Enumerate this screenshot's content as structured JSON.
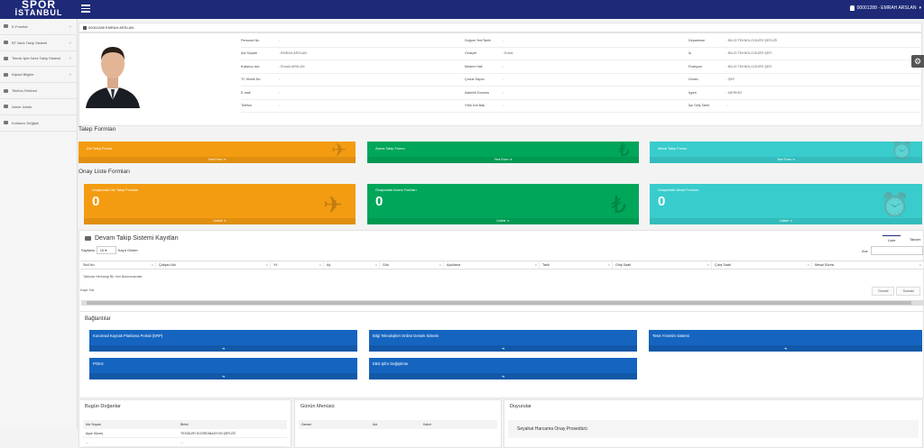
{
  "brand": {
    "line1": "SPOR",
    "line2": "İSTANBUL"
  },
  "user": {
    "label": "00001288 - EMRAH ARSLAN"
  },
  "sidebar": {
    "items": [
      {
        "label": "E-Formlar",
        "chevron": "˅"
      },
      {
        "label": "BT İstek Takip Sistemi",
        "chevron": "˅"
      },
      {
        "label": "Teknik İşler İstek Takip Sistemi",
        "chevron": "˅"
      },
      {
        "label": "Kişisel Bilgiler",
        "chevron": "˅"
      },
      {
        "label": "Telefon Rehberi",
        "chevron": ""
      },
      {
        "label": "İzinler İzinde",
        "chevron": ""
      },
      {
        "label": "Kullanıcı Değiştir",
        "chevron": ""
      }
    ]
  },
  "profile": {
    "header": "00001288 EMRAH ARSLAN",
    "rows": [
      [
        {
          "k": "Personel No",
          "v": ":"
        },
        {
          "k": "Doğum Yeri/Tarihi",
          "v": ":"
        },
        {
          "k": "Departman",
          "v": ": BİLGİ TEKNOLOJİLERİ ŞEFLİĞİ"
        }
      ],
      [
        {
          "k": "Adı Soyadı",
          "v": ": EMRAH ARSLAN"
        },
        {
          "k": "Cinsiyet",
          "v": ": Erkek"
        },
        {
          "k": "İş",
          "v": ": BİLGİ TEKNOLOJİLERİ ŞEFİ"
        }
      ],
      [
        {
          "k": "Kullanıcı Adı",
          "v": ": Emrah ARSLAN"
        },
        {
          "k": "Medeni Hali",
          "v": ":"
        },
        {
          "k": "Pozisyon",
          "v": ": BİLGİ TEKNOLOJİLERİ ŞEFİ"
        }
      ],
      [
        {
          "k": "TC Kimlik No",
          "v": ":"
        },
        {
          "k": "Çocuk Sayısı",
          "v": ":"
        },
        {
          "k": "Unvan",
          "v": ": ŞEF"
        }
      ],
      [
        {
          "k": "E-mail",
          "v": ":"
        },
        {
          "k": "Askerlik Durumu",
          "v": ":"
        },
        {
          "k": "İşyeri",
          "v": ": MERKEZ"
        }
      ],
      [
        {
          "k": "Telefon",
          "v": ":"
        },
        {
          "k": "Yıllık İzin Bak.",
          "v": ":"
        },
        {
          "k": "İşe Giriş Tarihi",
          "v": ":"
        }
      ]
    ]
  },
  "talep": {
    "title": "Talep Formları",
    "cards": [
      {
        "title": "İzin Talep Formu",
        "footer": "Yeni Form",
        "icon": "plane-icon",
        "glyph": "✈"
      },
      {
        "title": "Avans Talep Formu",
        "footer": "Yeni Form",
        "icon": "lira-icon",
        "glyph": "₺"
      },
      {
        "title": "Mesai Talep Formu",
        "footer": "Yeni Form",
        "icon": "alarm-clock-icon",
        "glyph": "⏰"
      }
    ]
  },
  "onay": {
    "title": "Onay Liste Formları",
    "cards": [
      {
        "title": "Onaymdaki İzin Talep Formları",
        "count": "0",
        "footer": "Listele",
        "icon": "plane-icon",
        "glyph": "✈"
      },
      {
        "title": "Onaymdaki Avans Formları",
        "count": "0",
        "footer": "Listele",
        "icon": "lira-icon",
        "glyph": "₺"
      },
      {
        "title": "Onaymdaki Mesai Formları",
        "count": "0",
        "footer": "Listele",
        "icon": "alarm-clock-icon",
        "glyph": "⏰"
      }
    ]
  },
  "devam": {
    "title": "Devam Takip Sistemi Kayıtları",
    "tabs": [
      "Liste",
      "Takvim"
    ],
    "page_label": "Sayfada",
    "page_size": "10",
    "page_suffix": "Kayıt Göster",
    "search_label": "Ara:",
    "columns": [
      "Sicil No",
      "Çalışan Adı",
      "Yıl",
      "Ay",
      "Gün",
      "Açıklama",
      "Tarih",
      "Giriş Saati",
      "Çıkış Saati",
      "Mesai Süresi"
    ],
    "empty": "Tabloda Herhangi Bir Veri Bulunmamakt",
    "info": "Kayıt Yok",
    "prev": "Önceki",
    "next": "Sonraki"
  },
  "baglantilar": {
    "title": "Bağlantılar",
    "links": [
      {
        "label": "Kurumsal Kaynak Planlama Portalı (ERP)"
      },
      {
        "label": "Bilgi Teknolojileri Online Destek Sistemi"
      },
      {
        "label": "Tesis Yönetim Sistemi"
      },
      {
        "label": "POKS"
      },
      {
        "label": "EBS Şifre Değiştirme"
      }
    ]
  },
  "bugun": {
    "title": "Bugün Doğanlar",
    "col1": "Adı Soyadı",
    "col2": "Birimi",
    "rows": [
      {
        "name": "Ayşe Güneş",
        "unit": "TESİSLER KOORDİNASYON ŞEFLİĞİ"
      },
      {
        "name": "...",
        "unit": "..."
      }
    ]
  },
  "menu": {
    "title": "Günün Menüsü",
    "col1": "Zaman",
    "col2": "Adı",
    "col3": "Kalori"
  },
  "duyurular": {
    "title": "Duyurular",
    "item": "Seyahat Harcama Onay Prosedürü"
  }
}
